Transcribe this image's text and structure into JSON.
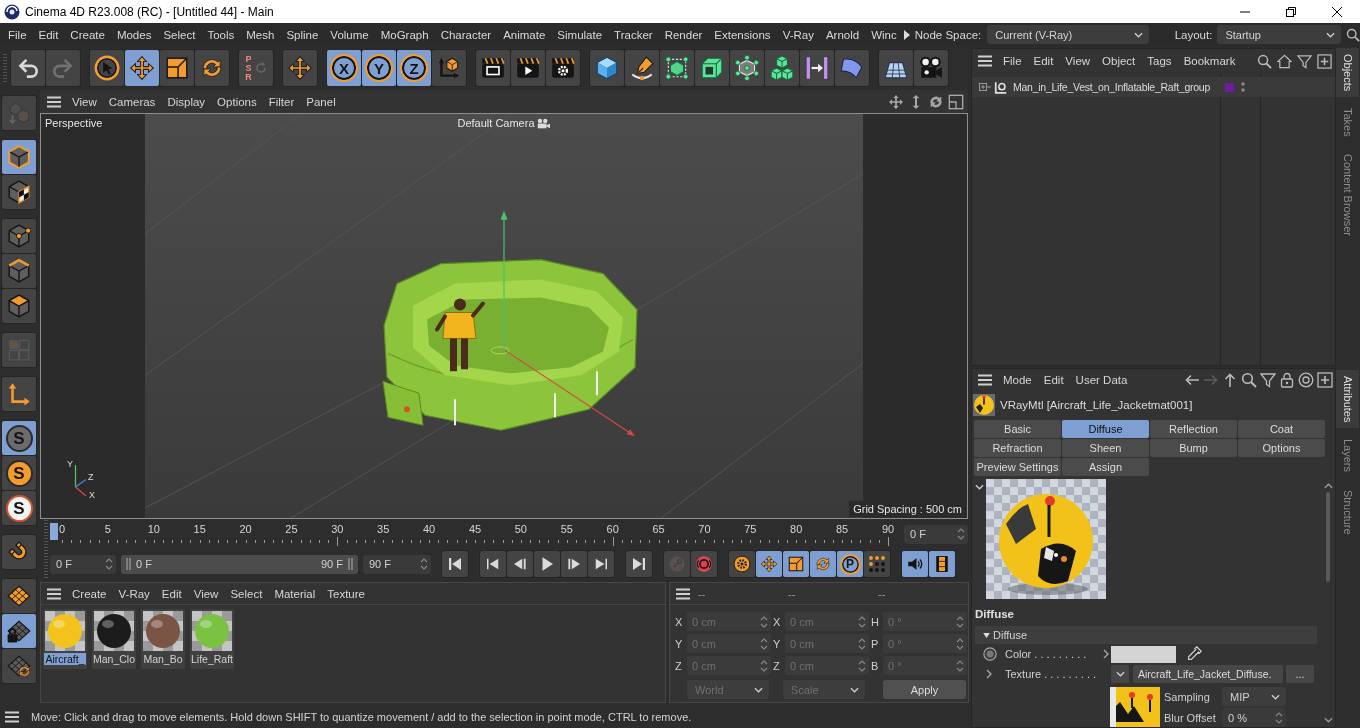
{
  "window": {
    "title": "Cinema 4D R23.008 (RC) - [Untitled 44] - Main"
  },
  "menu_bar": {
    "items": [
      "File",
      "Edit",
      "Create",
      "Modes",
      "Select",
      "Tools",
      "Mesh",
      "Spline",
      "Volume",
      "MoGraph",
      "Character",
      "Animate",
      "Simulate",
      "Tracker",
      "Render",
      "Extensions",
      "V-Ray",
      "Arnold",
      "Winc"
    ],
    "node_space": {
      "label": "Node Space:",
      "value": "Current (V-Ray)"
    },
    "layout": {
      "label": "Layout:",
      "value": "Startup"
    }
  },
  "toolbar": {
    "groups": [
      [
        {
          "kind": "undo",
          "selected": false,
          "disabled": false
        },
        {
          "kind": "redo",
          "selected": false,
          "disabled": true
        }
      ],
      [
        {
          "kind": "select",
          "selected": false,
          "disabled": false
        },
        {
          "kind": "move",
          "selected": true,
          "disabled": false
        },
        {
          "kind": "scale",
          "selected": false,
          "disabled": false
        },
        {
          "kind": "rotate",
          "selected": false,
          "disabled": false
        }
      ],
      [
        {
          "kind": "psr",
          "label": "P S R",
          "selected": false,
          "disabled": true
        }
      ],
      [
        {
          "kind": "gizmo",
          "selected": false,
          "disabled": false
        }
      ],
      [
        {
          "kind": "axis",
          "label": "X",
          "selected": true,
          "disabled": false
        },
        {
          "kind": "axis",
          "label": "Y",
          "selected": true,
          "disabled": false
        },
        {
          "kind": "axis",
          "label": "Z",
          "selected": true,
          "disabled": false
        },
        {
          "kind": "coord",
          "selected": false,
          "disabled": false
        }
      ],
      [
        {
          "kind": "renderview",
          "selected": false,
          "disabled": false
        },
        {
          "kind": "renderpv",
          "selected": false,
          "disabled": false
        },
        {
          "kind": "rendersettings",
          "selected": false,
          "disabled": false
        }
      ],
      [
        {
          "kind": "cube",
          "selected": false,
          "disabled": false
        },
        {
          "kind": "pen",
          "selected": false,
          "disabled": false
        },
        {
          "kind": "subdiv",
          "selected": false,
          "disabled": false
        },
        {
          "kind": "extrude",
          "selected": false,
          "disabled": false
        },
        {
          "kind": "cloner",
          "selected": false,
          "disabled": false
        },
        {
          "kind": "array",
          "selected": false,
          "disabled": false
        },
        {
          "kind": "field",
          "selected": false,
          "disabled": false
        },
        {
          "kind": "bend",
          "selected": false,
          "disabled": false
        }
      ],
      [
        {
          "kind": "floor",
          "selected": false,
          "disabled": false
        },
        {
          "kind": "camera",
          "selected": false,
          "disabled": false
        }
      ]
    ]
  },
  "tool_column": {
    "groups": [
      [
        {
          "kind": "editable",
          "selected": false,
          "disabled": true
        }
      ],
      [
        {
          "kind": "model",
          "selected": true,
          "disabled": false
        },
        {
          "kind": "texture",
          "selected": false,
          "disabled": false
        }
      ],
      [
        {
          "kind": "point",
          "selected": false,
          "disabled": false
        },
        {
          "kind": "edge",
          "selected": false,
          "disabled": false
        },
        {
          "kind": "polygon",
          "selected": false,
          "disabled": false
        }
      ],
      [
        {
          "kind": "uv",
          "selected": false,
          "disabled": true
        }
      ],
      [
        {
          "kind": "axismode",
          "selected": false,
          "disabled": false
        }
      ],
      [
        {
          "kind": "snap",
          "label": "S",
          "selected": true,
          "disabled": false
        },
        {
          "kind": "snaporange",
          "label": "S",
          "selected": false,
          "disabled": false
        },
        {
          "kind": "snapwhite",
          "label": "S",
          "selected": false,
          "disabled": false
        }
      ],
      [
        {
          "kind": "magnet",
          "selected": false,
          "disabled": false
        }
      ],
      [
        {
          "kind": "workplane",
          "selected": false,
          "disabled": false
        },
        {
          "kind": "workplanelock",
          "selected": true,
          "disabled": false
        },
        {
          "kind": "workplanerot",
          "selected": false,
          "disabled": false
        }
      ]
    ]
  },
  "viewport": {
    "menu": [
      "View",
      "Cameras",
      "Display",
      "Options",
      "Filter",
      "Panel"
    ],
    "view_name": "Perspective",
    "camera": "Default Camera",
    "grid_spacing": "Grid Spacing : 500 cm",
    "axis_labels": [
      "Y",
      "Z",
      "X"
    ]
  },
  "timeline": {
    "ticks": [
      "0",
      "5",
      "10",
      "15",
      "20",
      "25",
      "30",
      "35",
      "40",
      "45",
      "50",
      "55",
      "60",
      "65",
      "70",
      "75",
      "80",
      "85",
      "90"
    ],
    "level": 0,
    "frame": "0 F"
  },
  "playback": {
    "start": "0 F",
    "range": {
      "start": "0 F",
      "end": "90 F",
      "level": 1
    },
    "end": "90 F",
    "groups": [
      [
        {
          "kind": "first",
          "selected": false,
          "disabled": false
        }
      ],
      [
        {
          "kind": "prevkey",
          "selected": false,
          "disabled": false
        },
        {
          "kind": "prevframe",
          "selected": false,
          "disabled": false
        },
        {
          "kind": "play",
          "selected": false,
          "disabled": false
        },
        {
          "kind": "nextframe",
          "selected": false,
          "disabled": false
        },
        {
          "kind": "nextkey",
          "selected": false,
          "disabled": false
        }
      ],
      [
        {
          "kind": "last",
          "selected": false,
          "disabled": false
        }
      ],
      [
        {
          "kind": "record",
          "selected": false,
          "disabled": true
        },
        {
          "kind": "autokey",
          "selected": false,
          "disabled": false
        }
      ],
      [
        {
          "kind": "keysettings",
          "selected": false,
          "disabled": false
        },
        {
          "kind": "keymove",
          "selected": true,
          "disabled": false
        },
        {
          "kind": "keyscale",
          "selected": true,
          "disabled": false
        },
        {
          "kind": "keyrotate",
          "selected": true,
          "disabled": false
        },
        {
          "kind": "keyparam",
          "label": "P",
          "selected": true,
          "disabled": false
        },
        {
          "kind": "keypla",
          "selected": false,
          "disabled": false
        }
      ],
      [
        {
          "kind": "sound",
          "selected": true,
          "disabled": false
        },
        {
          "kind": "film",
          "selected": true,
          "disabled": false
        }
      ]
    ]
  },
  "materials": {
    "menu": [
      "Create",
      "V-Ray",
      "Edit",
      "View",
      "Select",
      "Material",
      "Texture"
    ],
    "items": [
      {
        "name": "Aircraft_",
        "color": "#f2c31c",
        "selected": true
      },
      {
        "name": "Man_Clo",
        "color": "#1c1c1c",
        "selected": false
      },
      {
        "name": "Man_Bo",
        "color": "#7a5545",
        "selected": false
      },
      {
        "name": "Life_Raft",
        "color": "#7cc242",
        "selected": false
      }
    ]
  },
  "coordinates": {
    "headers": [
      "--",
      "--",
      "--"
    ],
    "disabled": true,
    "rows": [
      {
        "pos_axis": "X",
        "position": "0 cm",
        "size_axis": "X",
        "size": "0 cm",
        "rot_axis": "H",
        "rotation": "0 °"
      },
      {
        "pos_axis": "Y",
        "position": "0 cm",
        "size_axis": "Y",
        "size": "0 cm",
        "rot_axis": "P",
        "rotation": "0 °"
      },
      {
        "pos_axis": "Z",
        "position": "0 cm",
        "size_axis": "Z",
        "size": "0 cm",
        "rot_axis": "B",
        "rotation": "0 °"
      }
    ],
    "space": "World",
    "size_mode": "Scale",
    "apply": "Apply"
  },
  "status_bar": {
    "text": "Move: Click and drag to move elements. Hold down SHIFT to quantize movement / add to the selection in point mode, CTRL to remove."
  },
  "objects": {
    "menu": [
      "File",
      "Edit",
      "View",
      "Object",
      "Tags",
      "Bookmark"
    ],
    "items": [
      {
        "name": "Man_in_Life_Vest_on_Inflatable_Raft_group",
        "expanded": false,
        "color": "#6c1f9c"
      }
    ]
  },
  "attributes": {
    "menu": [
      "Mode",
      "Edit",
      "User Data"
    ],
    "nav": [
      {
        "kind": "back",
        "disabled": false
      },
      {
        "kind": "forward",
        "disabled": true
      },
      {
        "kind": "up",
        "disabled": false
      },
      {
        "kind": "search",
        "disabled": false
      },
      {
        "kind": "filter",
        "disabled": false
      },
      {
        "kind": "lock",
        "disabled": false
      },
      {
        "kind": "target",
        "disabled": false
      },
      {
        "kind": "add",
        "disabled": false
      }
    ],
    "title": "VRayMtl [Aircraft_Life_Jacketmat001]",
    "tabs": [
      {
        "label": "Basic",
        "selected": false
      },
      {
        "label": "Diffuse",
        "selected": true
      },
      {
        "label": "Reflection",
        "selected": false
      },
      {
        "label": "Coat",
        "selected": false
      },
      {
        "label": "Refraction",
        "selected": false
      },
      {
        "label": "Sheen",
        "selected": false
      },
      {
        "label": "Bump",
        "selected": false
      },
      {
        "label": "Options",
        "selected": false
      },
      {
        "label": "Preview Settings",
        "selected": false
      },
      {
        "label": "Assign",
        "selected": false
      }
    ],
    "section": "Diffuse",
    "group": {
      "label": "Diffuse",
      "expanded": true
    },
    "params": [
      {
        "kind": "color",
        "label": "Color . . . . . . . . .",
        "color": "#d4d4d4"
      },
      {
        "kind": "texture",
        "label": "Texture . . . . . . . . .",
        "value": "Aircraft_Life_Jacket_Diffuse.",
        "more": "..."
      }
    ],
    "texture_options": [
      {
        "kind": "dropdown",
        "label": "Sampling",
        "value": "MIP"
      },
      {
        "kind": "spinner",
        "label": "Blur Offset",
        "value": "0 %"
      }
    ]
  },
  "side_tabs": {
    "top": [
      {
        "label": "Objects",
        "selected": true
      },
      {
        "label": "Takes",
        "selected": false
      },
      {
        "label": "Content Browser",
        "selected": false
      }
    ],
    "bottom": [
      {
        "label": "Attributes",
        "selected": true
      },
      {
        "label": "Layers",
        "selected": false
      },
      {
        "label": "Structure",
        "selected": false
      }
    ]
  }
}
